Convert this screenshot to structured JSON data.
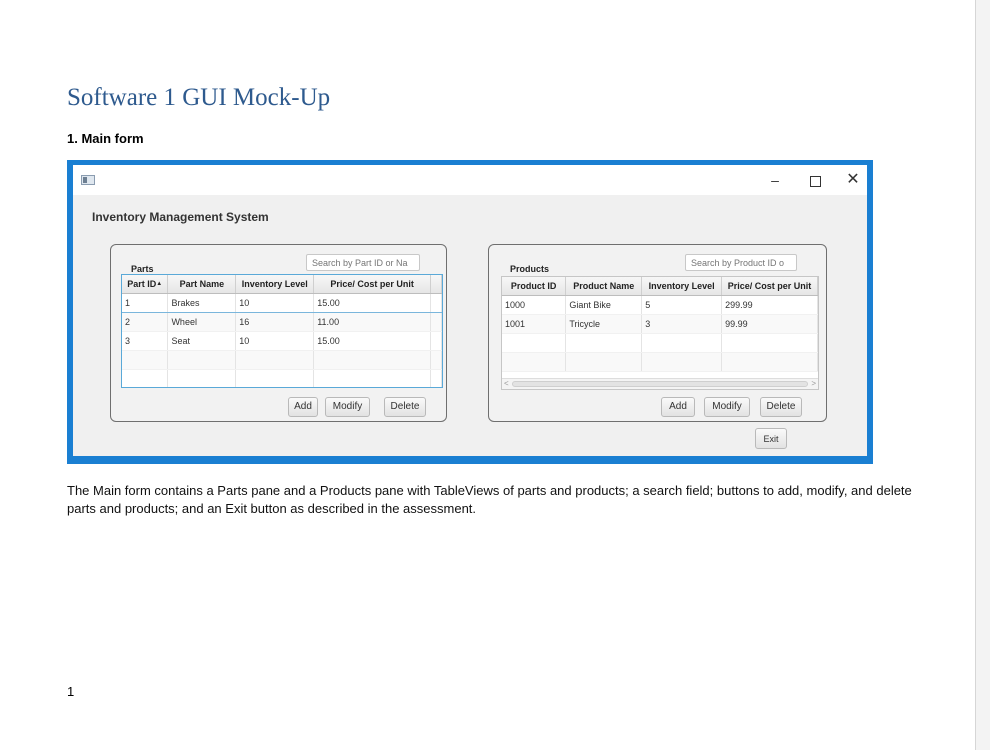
{
  "document": {
    "title": "Software 1 GUI Mock-Up",
    "section_heading": "1. Main form",
    "description": "The Main form contains a Parts pane and a Products pane with TableViews of parts and products; a search field; buttons to add, modify, and delete parts and products; and an Exit button as described in the assessment.",
    "page_number": "1"
  },
  "window": {
    "controls": {
      "minimize": "–",
      "close": "✕"
    },
    "app_title": "Inventory Management System",
    "parts": {
      "label": "Parts",
      "search_placeholder": "Search by Part ID or Na",
      "columns": [
        "Part ID",
        "Part Name",
        "Inventory Level",
        "Price/ Cost per Unit"
      ],
      "sort_indicator": "▲",
      "rows": [
        [
          "1",
          "Brakes",
          "10",
          "15.00"
        ],
        [
          "2",
          "Wheel",
          "16",
          "11.00"
        ],
        [
          "3",
          "Seat",
          "10",
          "15.00"
        ]
      ],
      "buttons": {
        "add": "Add",
        "modify": "Modify",
        "delete": "Delete"
      }
    },
    "products": {
      "label": "Products",
      "search_placeholder": "Search by Product ID o",
      "columns": [
        "Product ID",
        "Product Name",
        "Inventory Level",
        "Price/ Cost per Unit"
      ],
      "rows": [
        [
          "1000",
          "Giant Bike",
          "5",
          "299.99"
        ],
        [
          "1001",
          "Tricycle",
          "3",
          "99.99"
        ]
      ],
      "buttons": {
        "add": "Add",
        "modify": "Modify",
        "delete": "Delete"
      }
    },
    "exit_label": "Exit"
  },
  "colors": {
    "title_blue": "#2e5a8e",
    "window_frame": "#1a7fd2",
    "selection_border": "#5aa9d8"
  }
}
